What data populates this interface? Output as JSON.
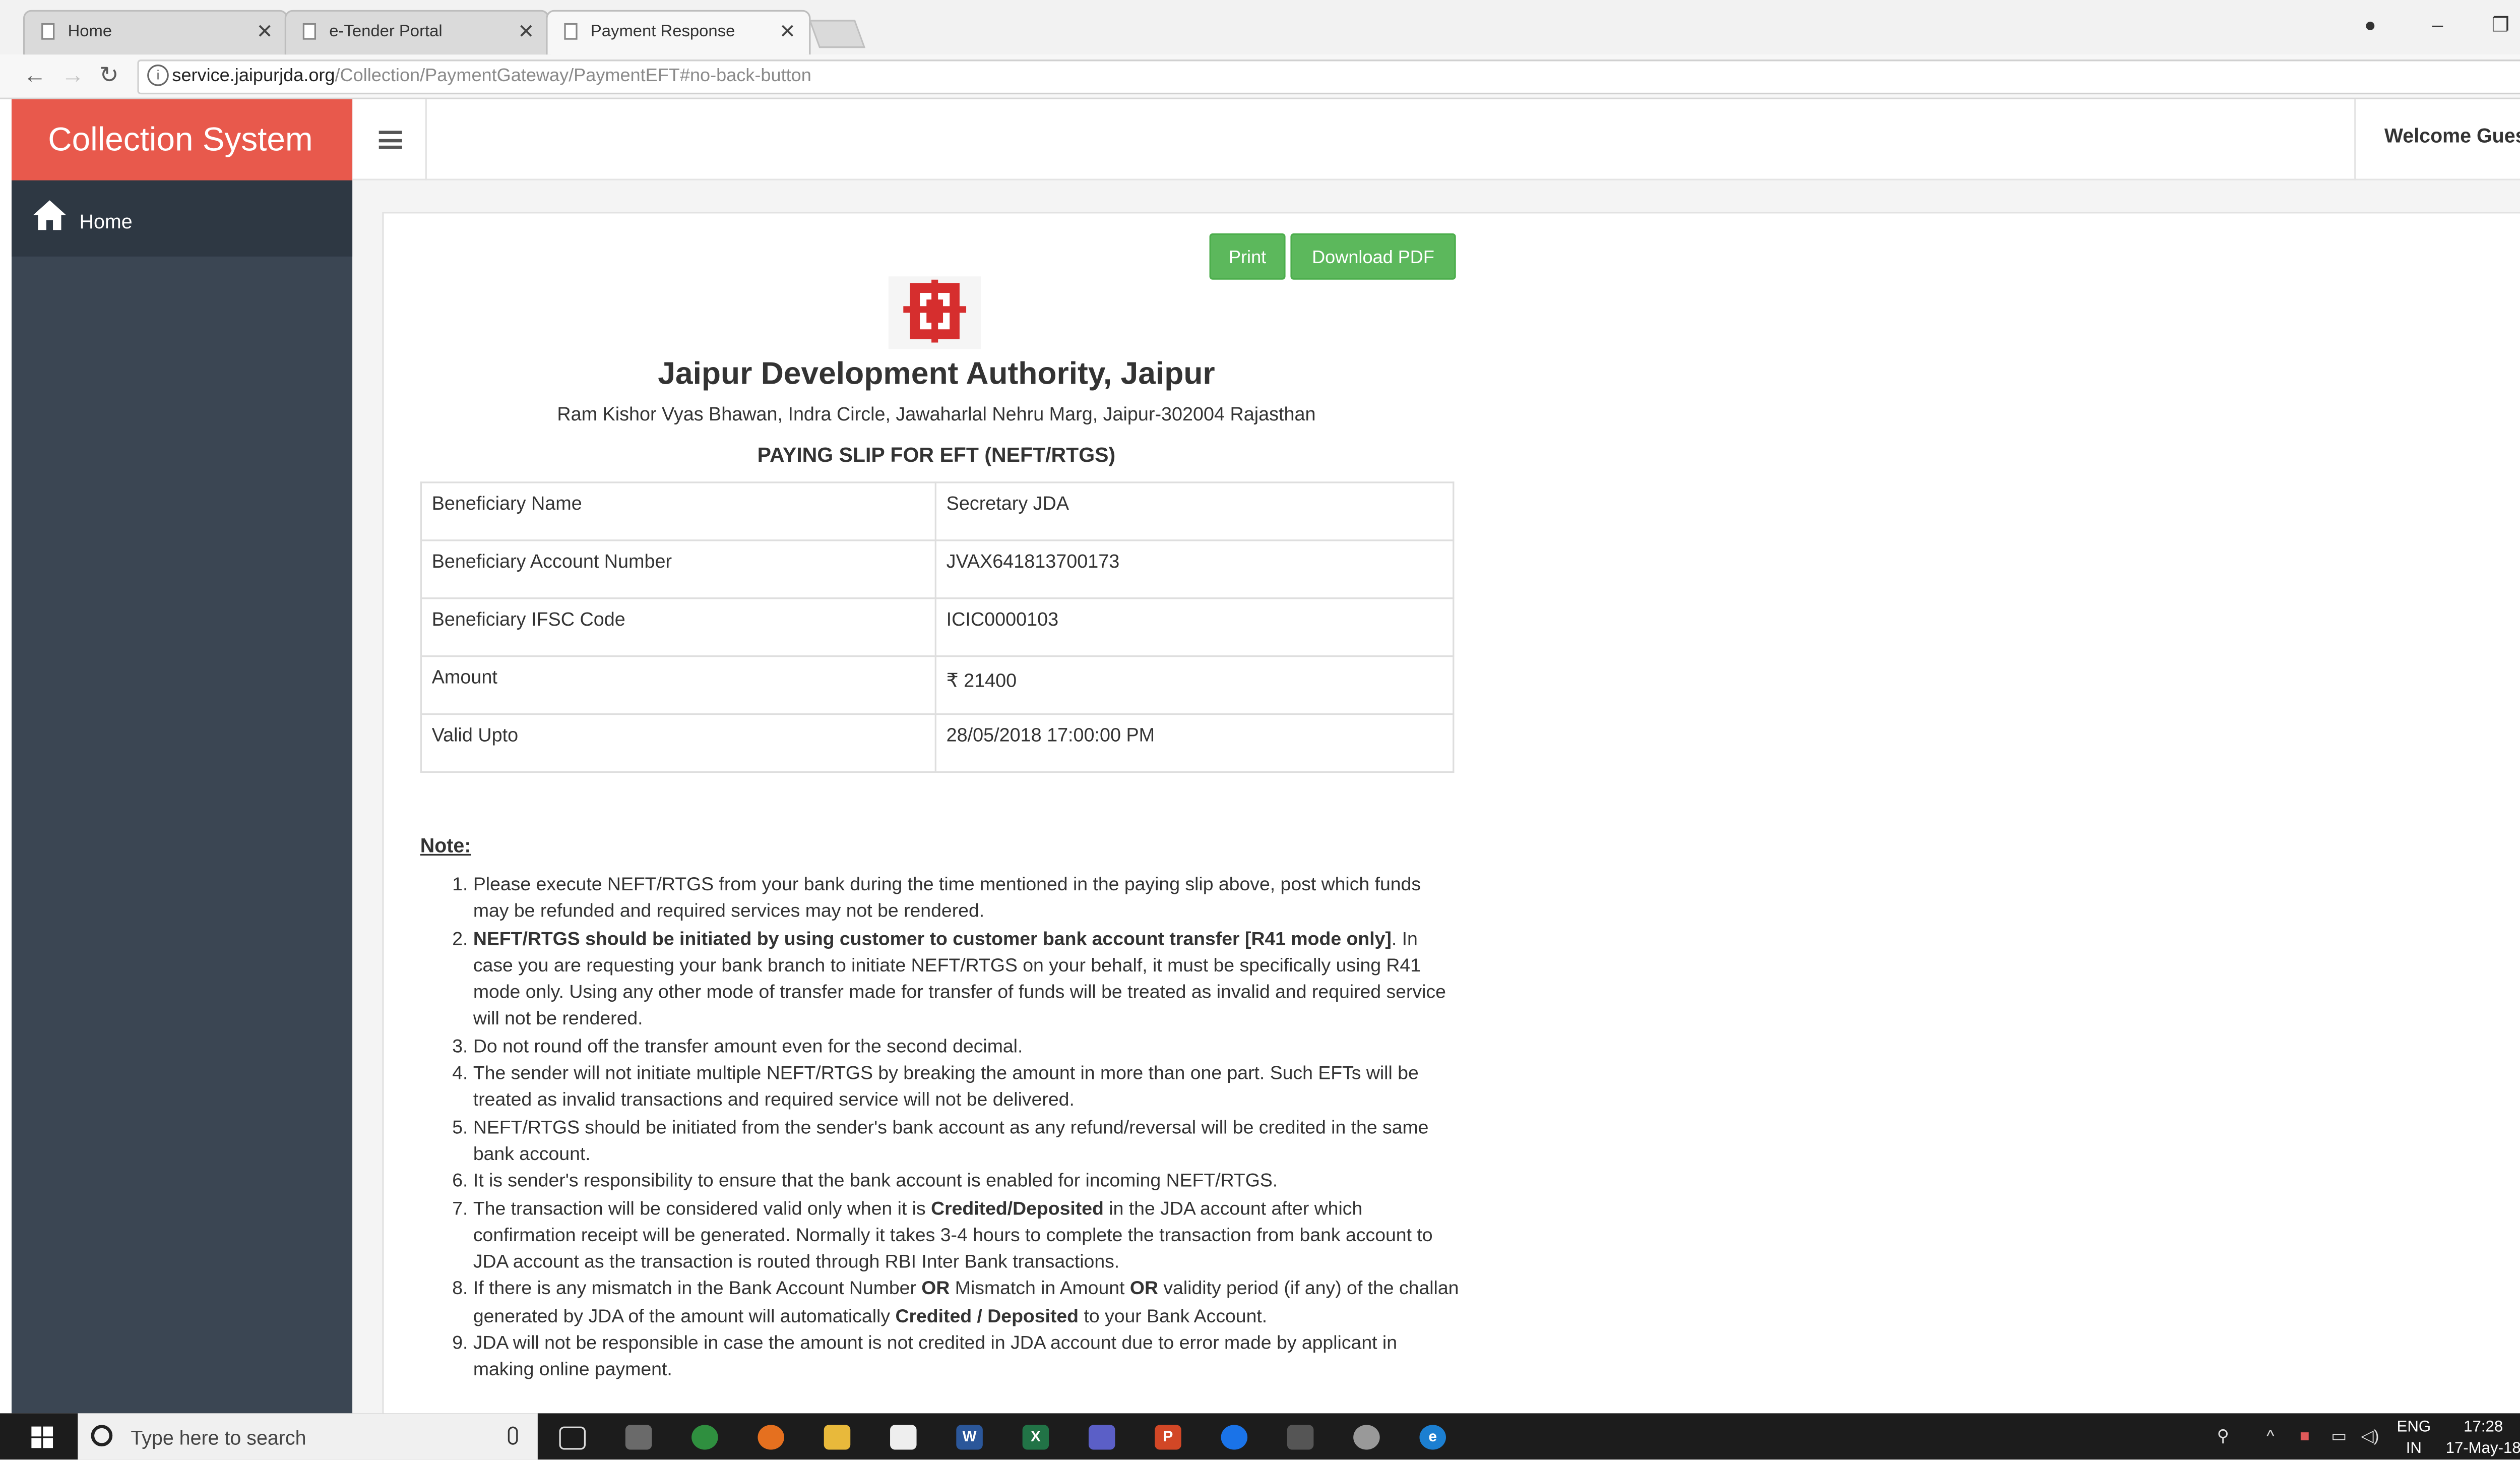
{
  "browser": {
    "tabs": [
      {
        "label": "Home",
        "active": false
      },
      {
        "label": "e-Tender Portal",
        "active": false
      },
      {
        "label": "Payment Response",
        "active": true
      }
    ],
    "url_host": "service.jaipurjda.org",
    "url_path": "/Collection/PaymentGateway/PaymentEFT#no-back-button"
  },
  "app": {
    "brand": "Collection System",
    "welcome": "Welcome Guest",
    "sidebar": {
      "items": [
        {
          "label": "Home",
          "icon": "home-icon"
        }
      ]
    },
    "colors": {
      "brand": "#e8594c",
      "sidebar": "#3b4653",
      "button": "#5cb85c"
    }
  },
  "actions": {
    "print": "Print",
    "download_pdf": "Download PDF"
  },
  "slip": {
    "org_name": "Jaipur Development Authority, Jaipur",
    "address": "Ram Kishor Vyas Bhawan, Indra Circle, Jawaharlal Nehru Marg, Jaipur-302004 Rajasthan",
    "title": "PAYING SLIP FOR EFT (NEFT/RTGS)",
    "rows": [
      {
        "label": "Beneficiary Name",
        "value": "Secretary JDA"
      },
      {
        "label": "Beneficiary Account Number",
        "value": "JVAX641813700173"
      },
      {
        "label": "Beneficiary IFSC Code",
        "value": "ICIC0000103"
      },
      {
        "label": "Amount",
        "value": "₹ 21400"
      },
      {
        "label": "Valid Upto",
        "value": "28/05/2018 17:00:00 PM"
      }
    ]
  },
  "notes": {
    "heading": "Note:",
    "items": [
      {
        "parts": [
          {
            "t": "Please execute NEFT/RTGS from your bank during the time mentioned in the paying slip above, post which funds may be refunded and required services may not be rendered.",
            "b": false
          }
        ]
      },
      {
        "parts": [
          {
            "t": "NEFT/RTGS should be initiated by using customer to customer bank account transfer [R41 mode only]",
            "b": true
          },
          {
            "t": ". In case you are requesting your bank branch to initiate NEFT/RTGS on your behalf, it must be specifically using R41 mode only. Using any other mode of transfer made for transfer of funds will be treated as invalid and required service will not be rendered.",
            "b": false
          }
        ]
      },
      {
        "parts": [
          {
            "t": "Do not round off the transfer amount even for the second decimal.",
            "b": false
          }
        ]
      },
      {
        "parts": [
          {
            "t": "The sender will not initiate multiple NEFT/RTGS by breaking the amount in more than one part. Such EFTs will be treated as invalid transactions and required service will not be delivered.",
            "b": false
          }
        ]
      },
      {
        "parts": [
          {
            "t": "NEFT/RTGS should be initiated from the sender's bank account as any refund/reversal will be credited in the same bank account.",
            "b": false
          }
        ]
      },
      {
        "parts": [
          {
            "t": "It is sender's responsibility to ensure that the bank account is enabled for incoming NEFT/RTGS.",
            "b": false
          }
        ]
      },
      {
        "parts": [
          {
            "t": "The transaction will be considered valid only when it is ",
            "b": false
          },
          {
            "t": "Credited/Deposited",
            "b": true
          },
          {
            "t": " in the JDA account after which confirmation receipt will be generated. Normally it takes 3-4 hours to complete the transaction from bank account to JDA account as the transaction is routed through RBI Inter Bank transactions.",
            "b": false
          }
        ]
      },
      {
        "parts": [
          {
            "t": "If there is any mismatch in the Bank Account Number ",
            "b": false
          },
          {
            "t": "OR",
            "b": true
          },
          {
            "t": " Mismatch in Amount ",
            "b": false
          },
          {
            "t": "OR",
            "b": true
          },
          {
            "t": " validity period (if any) of the challan generated by JDA of the amount will automatically ",
            "b": false
          },
          {
            "t": "Credited / Deposited",
            "b": true
          },
          {
            "t": " to your Bank Account.",
            "b": false
          }
        ]
      },
      {
        "parts": [
          {
            "t": "JDA will not be responsible in case the amount is not credited in JDA account due to error made by applicant in making online payment.",
            "b": false
          }
        ]
      }
    ]
  },
  "taskbar": {
    "search_placeholder": "Type here to search",
    "lang_line1": "ENG",
    "lang_line2": "IN",
    "time": "17:28",
    "date": "17-May-18"
  }
}
